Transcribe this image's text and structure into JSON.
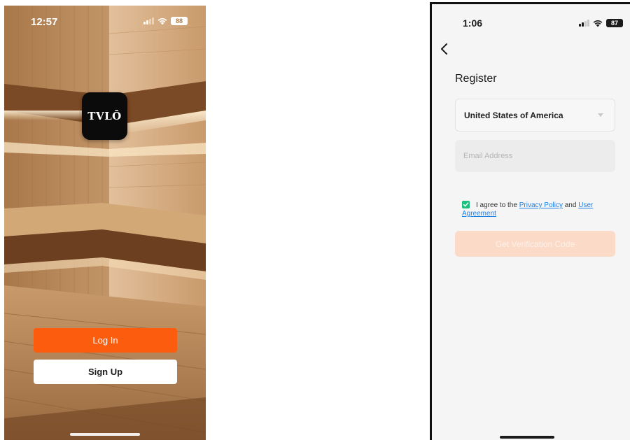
{
  "left_screen": {
    "status_bar": {
      "time": "12:57",
      "battery": "88"
    },
    "logo_text": "TVLŌ",
    "login_label": "Log In",
    "signup_label": "Sign Up",
    "colors": {
      "primary": "#fb5c0e"
    }
  },
  "right_screen": {
    "status_bar": {
      "time": "1:06",
      "battery": "87"
    },
    "title": "Register",
    "country_value": "United States of America",
    "email_placeholder": "Email Address",
    "agreement": {
      "prefix": "I agree to the",
      "privacy_link": "Privacy Policy",
      "conjunction": "and",
      "user_link": "User Agreement",
      "checked": true
    },
    "verify_button_label": "Get Verification Code",
    "colors": {
      "checkbox": "#19c17e",
      "link": "#1e7fe6",
      "disabled_button": "#fbdac8"
    }
  }
}
